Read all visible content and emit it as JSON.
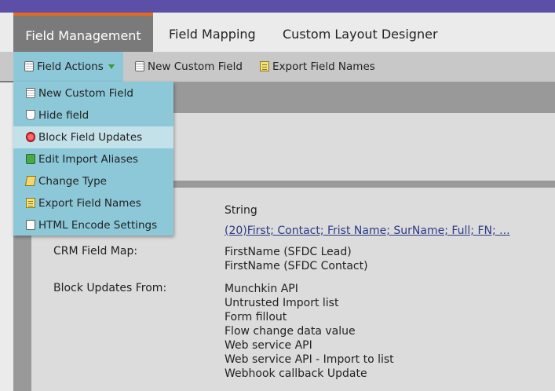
{
  "tabs": [
    {
      "label": "Field Management",
      "active": true
    },
    {
      "label": "Field Mapping",
      "active": false
    },
    {
      "label": "Custom Layout Designer",
      "active": false
    }
  ],
  "toolbar": {
    "field_actions": "Field Actions",
    "new_custom_field": "New Custom Field",
    "export_field_names": "Export Field Names"
  },
  "menu": {
    "items": [
      {
        "label": "New Custom Field",
        "icon": "database-icon"
      },
      {
        "label": "Hide field",
        "icon": "flask-icon"
      },
      {
        "label": "Block Field Updates",
        "icon": "stop-icon",
        "highlighted": true
      },
      {
        "label": "Edit Import Aliases",
        "icon": "alias-icon"
      },
      {
        "label": "Change Type",
        "icon": "edit-icon"
      },
      {
        "label": "Export Field Names",
        "icon": "document-icon"
      },
      {
        "label": "HTML Encode Settings",
        "icon": "html-icon"
      }
    ]
  },
  "details": {
    "type_value": "String",
    "aliases_value": "(20)First; Contact; Frist Name; SurName; Full; FN; ...",
    "crm_label": "CRM Field Map:",
    "crm_values": [
      "FirstName (SFDC Lead)",
      "FirstName (SFDC Contact)"
    ],
    "block_label": "Block Updates From:",
    "block_values": [
      "Munchkin API",
      "Untrusted Import list",
      "Form fillout",
      "Flow change data value",
      "Web service API",
      "Web service API - Import to list",
      "Webhook callback Update"
    ]
  },
  "colors": {
    "header_purple": "#5b4fa7",
    "active_tab": "#7a7a7a",
    "tab_accent": "#e46a1f",
    "menu_bg": "#8cc8d8",
    "menu_highlight": "#c3e1e9",
    "link": "#2b3a86"
  }
}
